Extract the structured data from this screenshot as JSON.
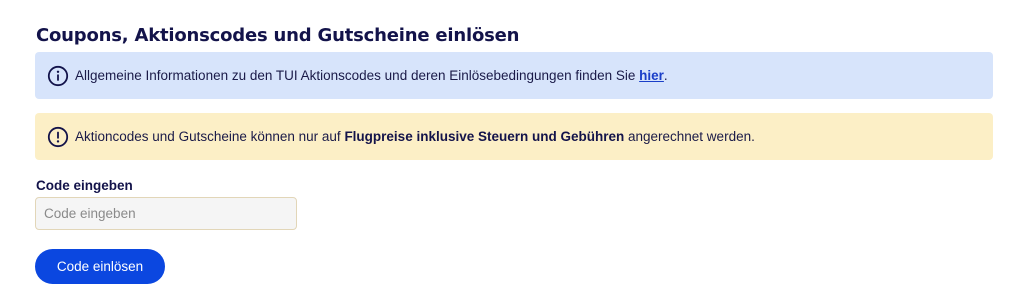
{
  "section": {
    "title": "Coupons, Aktionscodes und Gutscheine einlösen"
  },
  "info_notice": {
    "icon": "info-circle-icon",
    "text_before": "Allgemeine Informationen zu den TUI Aktionscodes und deren Einlösebedingungen finden Sie ",
    "link_label": "hier",
    "text_after": ".",
    "background": "#d7e4fb"
  },
  "warning_notice": {
    "icon": "exclamation-circle-icon",
    "text_before": "Aktioncodes und Gutscheine können nur auf ",
    "text_bold": "Flugpreise inklusive Steuern und Gebühren",
    "text_after": " angerechnet werden.",
    "background": "#fcefc6"
  },
  "code_form": {
    "label": "Code eingeben",
    "input_value": "",
    "input_placeholder": "Code eingeben",
    "submit_label": "Code einlösen",
    "accent": "#0b47e0"
  }
}
